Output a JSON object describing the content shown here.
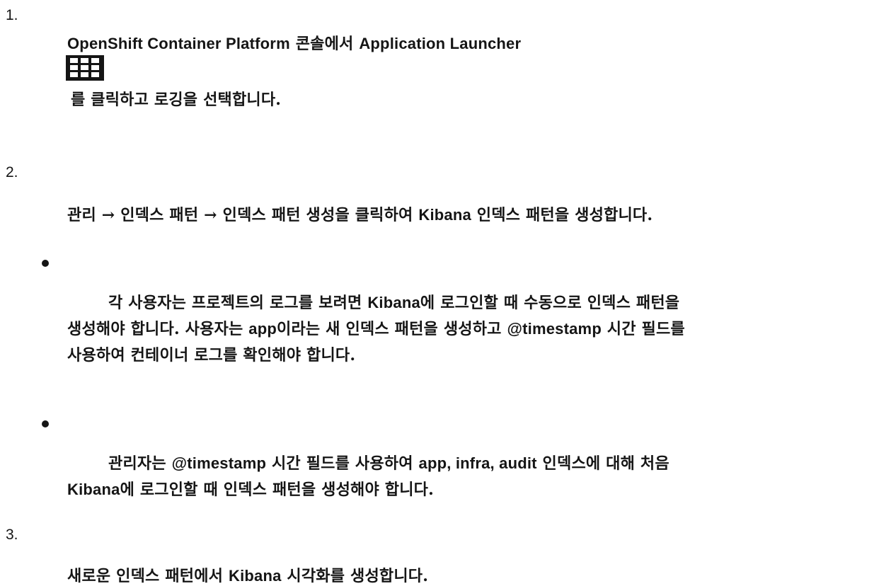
{
  "steps": [
    {
      "number": "1.",
      "line1_a": "OpenShift Container Platform",
      "line1_b": " 콘솔에서 ",
      "line1_c": "Application Launcher",
      "icon": "application-launcher-grid-icon",
      "line2": "를 클릭하고 로깅을 선택합니다."
    },
    {
      "number": "2.",
      "text_a": "관리 → 인덱스 패턴 → 인덱스 패턴 생성을 클릭하여 ",
      "text_b": "Kibana",
      "text_c": " 인덱스 패턴을 생성합니다.",
      "notes": [
        {
          "l1_a": "각 사용자는 프로젝트의 로그를 보려면 ",
          "l1_b": "Kibana",
          "l1_c": "에 로그인할 때 수동으로 인덱스 패턴을",
          "l2_a": "생성해야 합니다. 사용자는 ",
          "l2_b": "app",
          "l2_c": "이라는 새 인덱스 패턴을 생성하고 ",
          "l2_d": "@timestamp",
          "l2_e": " 시간 필드를",
          "l3": "사용하여 컨테이너 로그를 확인해야 합니다."
        },
        {
          "l1_a": "관리자는 ",
          "l1_b": "@timestamp",
          "l1_c": " 시간 필드를 사용하여 ",
          "l1_d": "app, infra, audit",
          "l1_e": " 인덱스에 대해 처음",
          "l2_a": "Kibana",
          "l2_b": "에 로그인할 때 인덱스 패턴을 생성해야 합니다."
        }
      ]
    },
    {
      "number": "3.",
      "text_a": "새로운 인덱스 패턴에서 ",
      "text_b": "Kibana",
      "text_c": " 시각화를 생성합니다."
    }
  ]
}
